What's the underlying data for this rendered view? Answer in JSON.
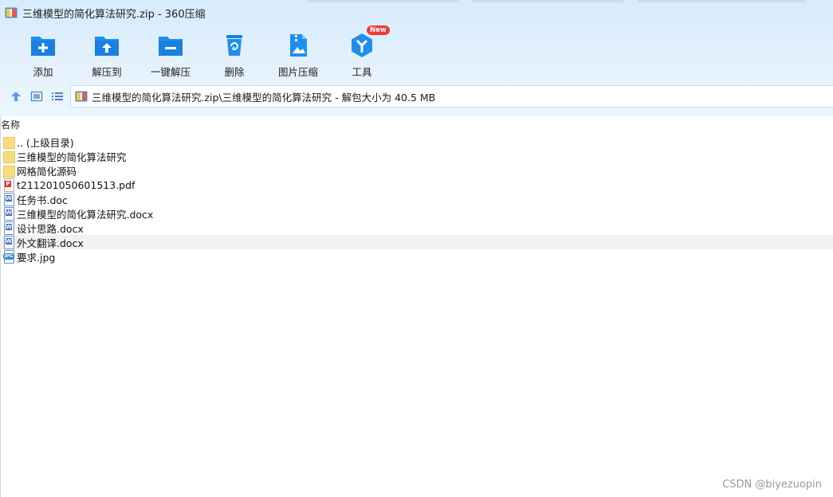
{
  "window": {
    "title": "三维模型的简化算法研究.zip - 360压缩"
  },
  "toolbar": {
    "items": [
      {
        "label": "添加",
        "icon": "add-folder-icon"
      },
      {
        "label": "解压到",
        "icon": "extract-to-icon"
      },
      {
        "label": "一键解压",
        "icon": "one-click-extract-icon"
      },
      {
        "label": "删除",
        "icon": "trash-icon"
      },
      {
        "label": "图片压缩",
        "icon": "image-compress-icon"
      },
      {
        "label": "工具",
        "icon": "tools-icon",
        "badge": "New"
      }
    ]
  },
  "address": {
    "path": "三维模型的简化算法研究.zip\\三维模型的简化算法研究 - 解包大小为 40.5 MB"
  },
  "list": {
    "column_name": "名称",
    "files": [
      {
        "name": ".. (上级目录)",
        "type": "folder"
      },
      {
        "name": "三维模型的简化算法研究",
        "type": "folder"
      },
      {
        "name": "网格简化源码",
        "type": "folder"
      },
      {
        "name": "t211201050601513.pdf",
        "type": "pdf"
      },
      {
        "name": "任务书.doc",
        "type": "doc"
      },
      {
        "name": "三维模型的简化算法研究.docx",
        "type": "doc"
      },
      {
        "name": "设计思路.docx",
        "type": "doc"
      },
      {
        "name": "外文翻译.docx",
        "type": "doc",
        "hover": true
      },
      {
        "name": "要求.jpg",
        "type": "jpg"
      }
    ]
  },
  "watermark": "CSDN @biyezuopin",
  "colors": {
    "accent": "#1f8ef1",
    "header_bg": "#dcedfb",
    "new_badge": "#f03a3a"
  }
}
